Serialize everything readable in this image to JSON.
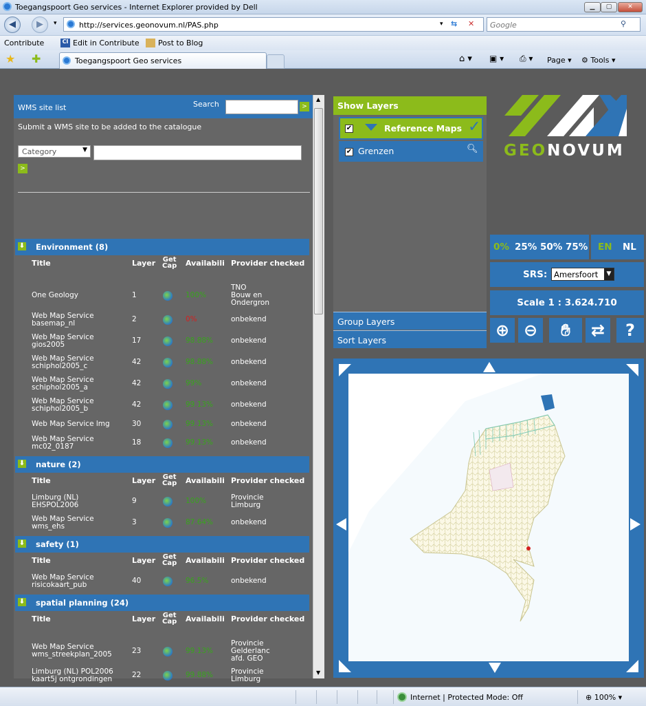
{
  "browser": {
    "title": "Toegangspoort Geo services - Internet Explorer provided by Dell",
    "url": "http://services.geonovum.nl/PAS.php",
    "search_placeholder": "Google",
    "links": {
      "contribute": "Contribute",
      "edit": "Edit in Contribute",
      "post": "Post to Blog"
    },
    "tab_title": "Toegangspoort Geo services",
    "cmd": {
      "page": "Page",
      "tools": "Tools"
    },
    "status": {
      "zone": "Internet | Protected Mode: Off",
      "zoom": "100%"
    }
  },
  "left": {
    "header_link": "WMS site list",
    "search_label": "Search",
    "go": ">",
    "submit_text": "Submit a WMS site to be added to the catalogue",
    "category_placeholder": "Category",
    "columns": {
      "title": "Title",
      "layer": "Layer",
      "getcap": "Get\nCap",
      "avail": "Availabili",
      "provider": "Provider checked"
    },
    "sections": [
      {
        "name": "Environment (8)",
        "rows": [
          {
            "title": "One Geology",
            "layer": "1",
            "avail": "100%",
            "status": "g",
            "provider": "TNO\nBouw en\nOndergron"
          },
          {
            "title": "Web Map Service\nbasemap_nl",
            "layer": "2",
            "avail": "0%",
            "status": "r",
            "provider": "onbekend"
          },
          {
            "title": "Web Map Service\ngios2005",
            "layer": "17",
            "avail": "98.88%",
            "status": "g",
            "provider": "onbekend"
          },
          {
            "title": "Web Map Service\nschiphol2005_c",
            "layer": "42",
            "avail": "98.88%",
            "status": "g",
            "provider": "onbekend"
          },
          {
            "title": "Web Map Service\nschiphol2005_a",
            "layer": "42",
            "avail": "99%",
            "status": "g",
            "provider": "onbekend"
          },
          {
            "title": "Web Map Service\nschiphol2005_b",
            "layer": "42",
            "avail": "99.13%",
            "status": "g",
            "provider": "onbekend"
          },
          {
            "title": "Web Map Service lmg",
            "layer": "30",
            "avail": "99.13%",
            "status": "g",
            "provider": "onbekend"
          },
          {
            "title": "Web Map Service\nmc02_0187",
            "layer": "18",
            "avail": "99.13%",
            "status": "g",
            "provider": "onbekend"
          }
        ]
      },
      {
        "name": "nature (2)",
        "rows": [
          {
            "title": "Limburg (NL)\nEHSPOL2006",
            "layer": "9",
            "avail": "100%",
            "status": "g",
            "provider": "Provincie\nLimburg"
          },
          {
            "title": "Web Map Service\nwms_ehs",
            "layer": "3",
            "avail": "87.64%",
            "status": "g",
            "provider": "onbekend"
          }
        ]
      },
      {
        "name": "safety (1)",
        "rows": [
          {
            "title": "Web Map Service\nrisicokaart_pub",
            "layer": "40",
            "avail": "96.5%",
            "status": "g",
            "provider": "onbekend"
          }
        ]
      },
      {
        "name": "spatial planning (24)",
        "rows": [
          {
            "title": "Web Map Service\nwms_streekplan_2005",
            "layer": "23",
            "avail": "99.13%",
            "status": "g",
            "provider": "Provincie\nGelderlanc\nafd. GEO"
          },
          {
            "title": "Limburg (NL) POL2006\nkaart5j ontgrondingen",
            "layer": "22",
            "avail": "99.88%",
            "status": "g",
            "provider": "Provincie\nLimburg"
          }
        ]
      }
    ]
  },
  "layers": {
    "show": "Show Layers",
    "items": [
      {
        "name": "Reference Maps"
      },
      {
        "name": "Grenzen"
      }
    ],
    "group": "Group Layers",
    "sort": "Sort Layers"
  },
  "controls": {
    "logo_geo": "GEO",
    "logo_rest": "NOVUM",
    "opacity": [
      "0%",
      "25%",
      "50%",
      "75%"
    ],
    "lang": [
      "EN",
      "NL"
    ],
    "srs_label": "SRS:",
    "srs_value": "Amersfoort",
    "scale": "Scale 1 : 3.624.710"
  },
  "colors": {
    "blue": "#2f74b5",
    "green": "#8cbb1b",
    "gray": "#666666"
  }
}
